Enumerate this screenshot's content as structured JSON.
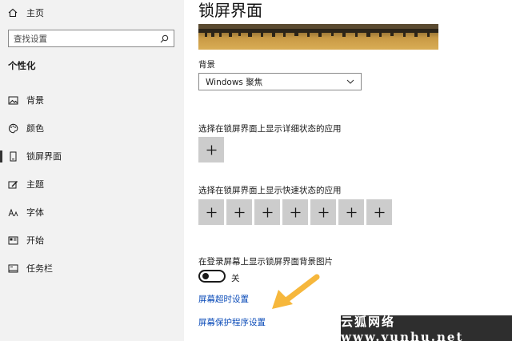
{
  "sidebar": {
    "home_label": "主页",
    "search_placeholder": "查找设置",
    "section_title": "个性化",
    "items": [
      {
        "label": "背景",
        "icon": "image-icon"
      },
      {
        "label": "颜色",
        "icon": "palette-icon"
      },
      {
        "label": "锁屏界面",
        "icon": "lock-screen-icon",
        "active": true
      },
      {
        "label": "主题",
        "icon": "theme-brush-icon"
      },
      {
        "label": "字体",
        "icon": "font-icon"
      },
      {
        "label": "开始",
        "icon": "start-menu-icon"
      },
      {
        "label": "任务栏",
        "icon": "taskbar-icon"
      }
    ]
  },
  "main": {
    "title": "锁屏界面",
    "background_label": "背景",
    "background_value": "Windows 聚焦",
    "detailed_status_label": "选择在锁屏界面上显示详细状态的应用",
    "quick_status_label": "选择在锁屏界面上显示快速状态的应用",
    "quick_status_slots": 7,
    "signin_bg_label": "在登录屏幕上显示锁屏界面背景图片",
    "signin_bg_state": "关",
    "screen_timeout_link": "屏幕超时设置",
    "screensaver_link": "屏幕保护程序设置"
  },
  "watermark": "云狐网络 www.yunhu.net",
  "colors": {
    "sidebar_bg": "#f2f2f2",
    "link": "#0a4bb8",
    "plus_tile": "#cccccc",
    "arrow": "#f6b73c"
  }
}
